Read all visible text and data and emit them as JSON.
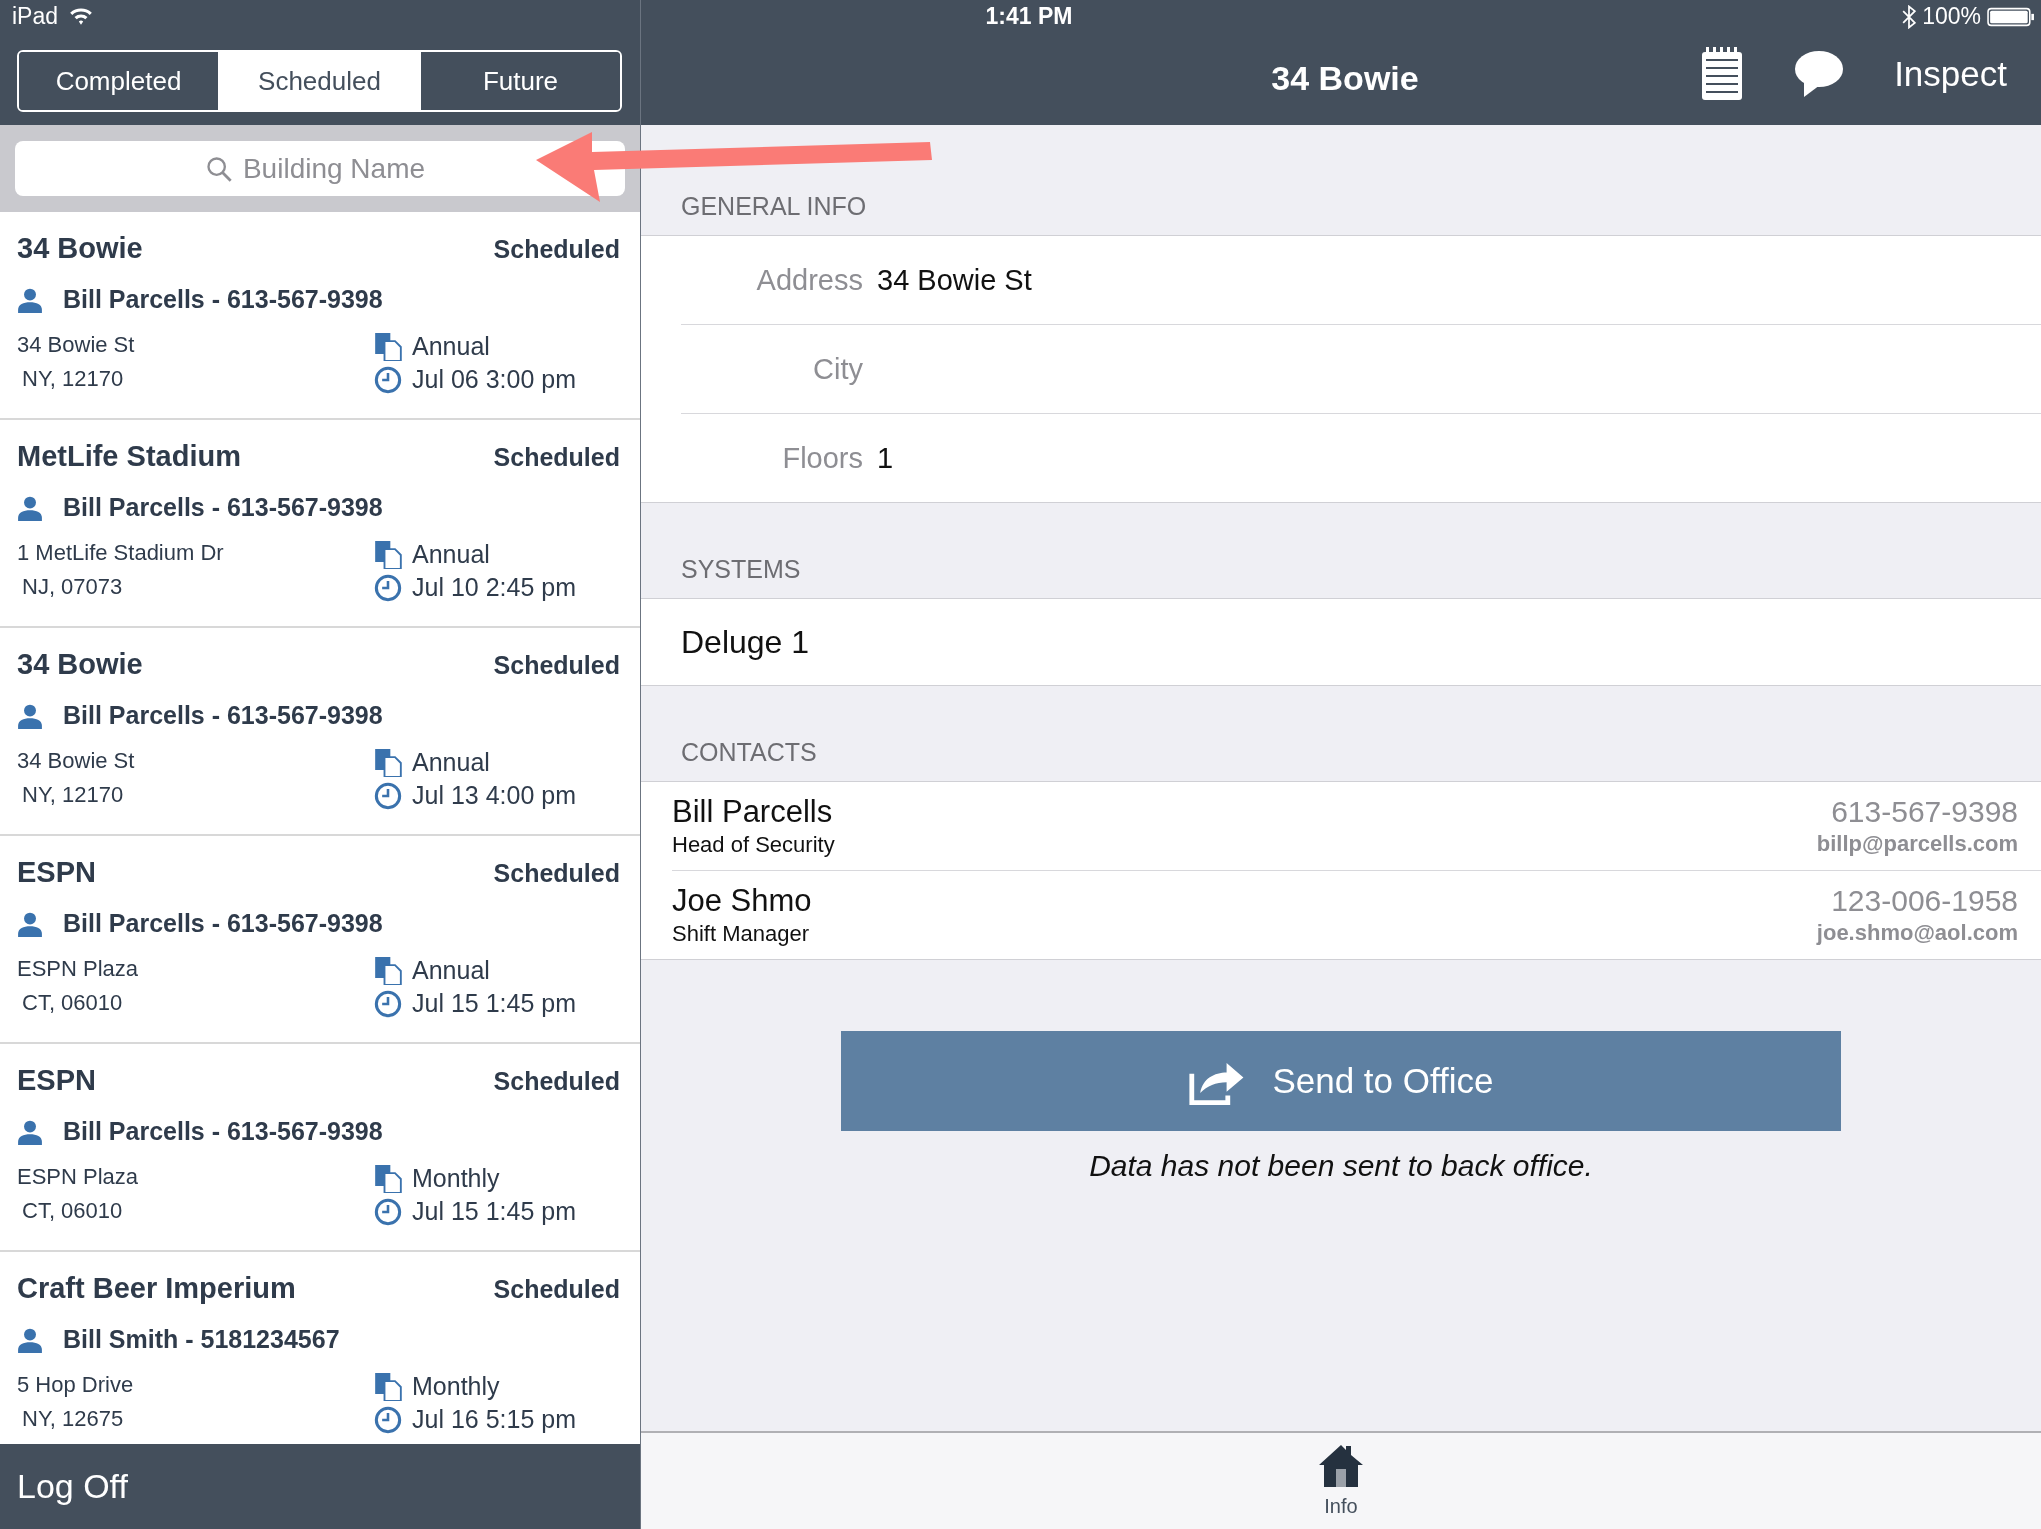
{
  "status_bar": {
    "device": "iPad",
    "time": "1:41 PM",
    "battery": "100%"
  },
  "segments": [
    {
      "label": "Completed",
      "selected": false
    },
    {
      "label": "Scheduled",
      "selected": true
    },
    {
      "label": "Future",
      "selected": false
    }
  ],
  "search": {
    "placeholder": "Building Name"
  },
  "inspections": [
    {
      "name": "34 Bowie",
      "status": "Scheduled",
      "contact": "Bill Parcells - 613-567-9398",
      "address_line1": "34 Bowie St",
      "address_line2": "NY, 12170",
      "frequency": "Annual",
      "datetime": "Jul 06 3:00 pm"
    },
    {
      "name": "MetLife Stadium",
      "status": "Scheduled",
      "contact": "Bill Parcells - 613-567-9398",
      "address_line1": "1 MetLife Stadium Dr",
      "address_line2": "NJ, 07073",
      "frequency": "Annual",
      "datetime": "Jul 10 2:45 pm"
    },
    {
      "name": "34 Bowie",
      "status": "Scheduled",
      "contact": "Bill Parcells - 613-567-9398",
      "address_line1": "34 Bowie St",
      "address_line2": "NY, 12170",
      "frequency": "Annual",
      "datetime": "Jul 13 4:00 pm"
    },
    {
      "name": "ESPN",
      "status": "Scheduled",
      "contact": "Bill Parcells - 613-567-9398",
      "address_line1": "ESPN Plaza",
      "address_line2": "CT, 06010",
      "frequency": "Annual",
      "datetime": "Jul 15 1:45 pm"
    },
    {
      "name": "ESPN",
      "status": "Scheduled",
      "contact": "Bill Parcells - 613-567-9398",
      "address_line1": "ESPN Plaza",
      "address_line2": "CT, 06010",
      "frequency": "Monthly",
      "datetime": "Jul 15 1:45 pm"
    },
    {
      "name": "Craft Beer Imperium",
      "status": "Scheduled",
      "contact": "Bill Smith - 5181234567",
      "address_line1": "5 Hop Drive",
      "address_line2": "NY, 12675",
      "frequency": "Monthly",
      "datetime": "Jul 16 5:15 pm"
    }
  ],
  "logoff": "Log Off",
  "nav": {
    "title": "34 Bowie",
    "action": "Inspect"
  },
  "general_info": {
    "header": "GENERAL INFO",
    "fields": [
      {
        "label": "Address",
        "value": "34 Bowie St"
      },
      {
        "label": "City"
      },
      {
        "label": "Floors",
        "value": "1"
      }
    ]
  },
  "systems": {
    "header": "SYSTEMS",
    "items": [
      "Deluge 1"
    ]
  },
  "contacts": {
    "header": "CONTACTS",
    "items": [
      {
        "name": "Bill Parcells",
        "role": "Head of Security",
        "phone": "613-567-9398",
        "email": "billp@parcells.com"
      },
      {
        "name": "Joe Shmo",
        "role": "Shift Manager",
        "phone": "123-006-1958",
        "email": "joe.shmo@aol.com"
      }
    ]
  },
  "send_button": "Send to Office",
  "send_status": "Data has not been sent to back office.",
  "tab_bar": {
    "label": "Info"
  }
}
